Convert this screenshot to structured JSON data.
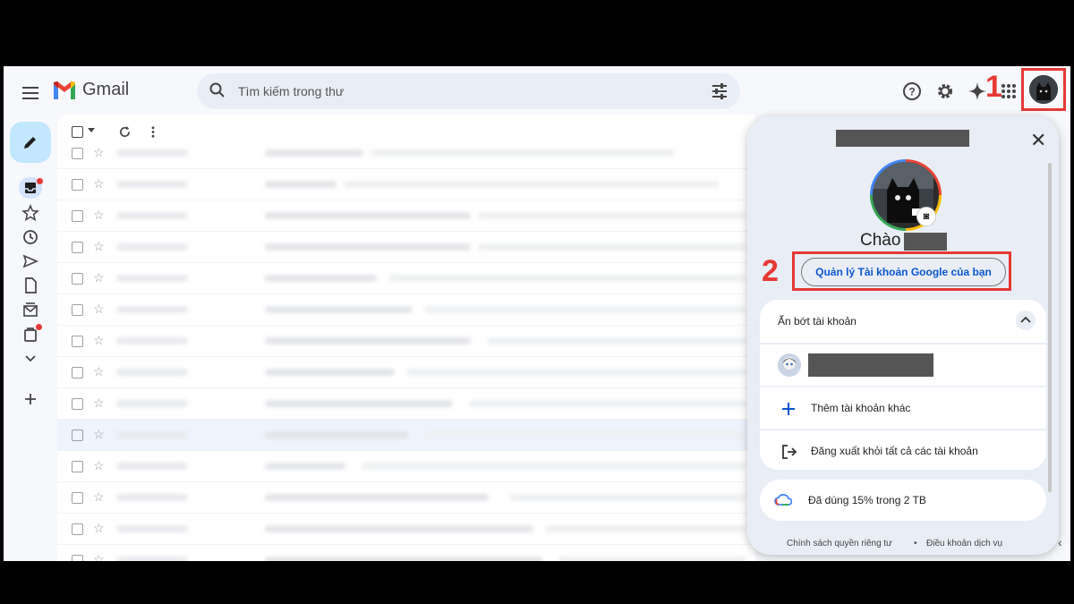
{
  "header": {
    "brand": "Gmail",
    "search_placeholder": "Tìm kiếm trong thư"
  },
  "annotations": {
    "step1": "1",
    "step2": "2"
  },
  "account_panel": {
    "greeting": "Chào",
    "manage_button": "Quản lý Tài khoản Google của bạn",
    "hide_accounts": "Ẩn bớt tài khoản",
    "add_account": "Thêm tài khoản khác",
    "sign_out_all": "Đăng xuất khỏi tất cả các tài khoản",
    "storage": "Đã dùng 15% trong 2 TB",
    "footer_privacy": "Chính sách quyền riêng tư",
    "footer_separator": "•",
    "footer_terms": "Điều khoản dịch vụ"
  },
  "colors": {
    "annotation_red": "#e53935",
    "link_blue": "#0b57d0",
    "compose_bg": "#c2e7ff"
  }
}
